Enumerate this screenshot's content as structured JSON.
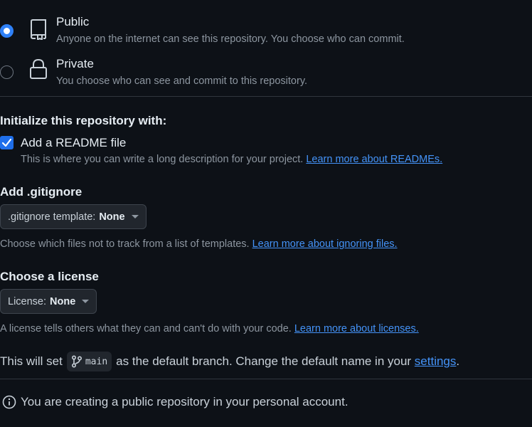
{
  "visibility": {
    "options": [
      {
        "title": "Public",
        "description": "Anyone on the internet can see this repository. You choose who can commit.",
        "icon": "repo-icon",
        "selected": true
      },
      {
        "title": "Private",
        "description": "You choose who can see and commit to this repository.",
        "icon": "lock-icon",
        "selected": false
      }
    ]
  },
  "init": {
    "heading": "Initialize this repository with:",
    "readme_label": "Add a README file",
    "readme_checked": true,
    "readme_help": "This is where you can write a long description for your project.",
    "readme_link": "Learn more about READMEs."
  },
  "gitignore": {
    "heading": "Add .gitignore",
    "select_prefix": ".gitignore template:",
    "select_value": "None",
    "help": "Choose which files not to track from a list of templates.",
    "link": "Learn more about ignoring files."
  },
  "license": {
    "heading": "Choose a license",
    "select_prefix": "License:",
    "select_value": "None",
    "help": "A license tells others what they can and can't do with your code.",
    "link": "Learn more about licenses."
  },
  "branch": {
    "prefix": "This will set",
    "branch_name": "main",
    "middle": "as the default branch. Change the default name in your",
    "settings_link": "settings",
    "suffix": "."
  },
  "notice": {
    "text": "You are creating a public repository in your personal account.",
    "icon": "info-icon"
  },
  "colors": {
    "background": "#0d1117",
    "accent": "#2f81f7",
    "link": "#4493f8",
    "muted_text": "#8d96a0"
  }
}
